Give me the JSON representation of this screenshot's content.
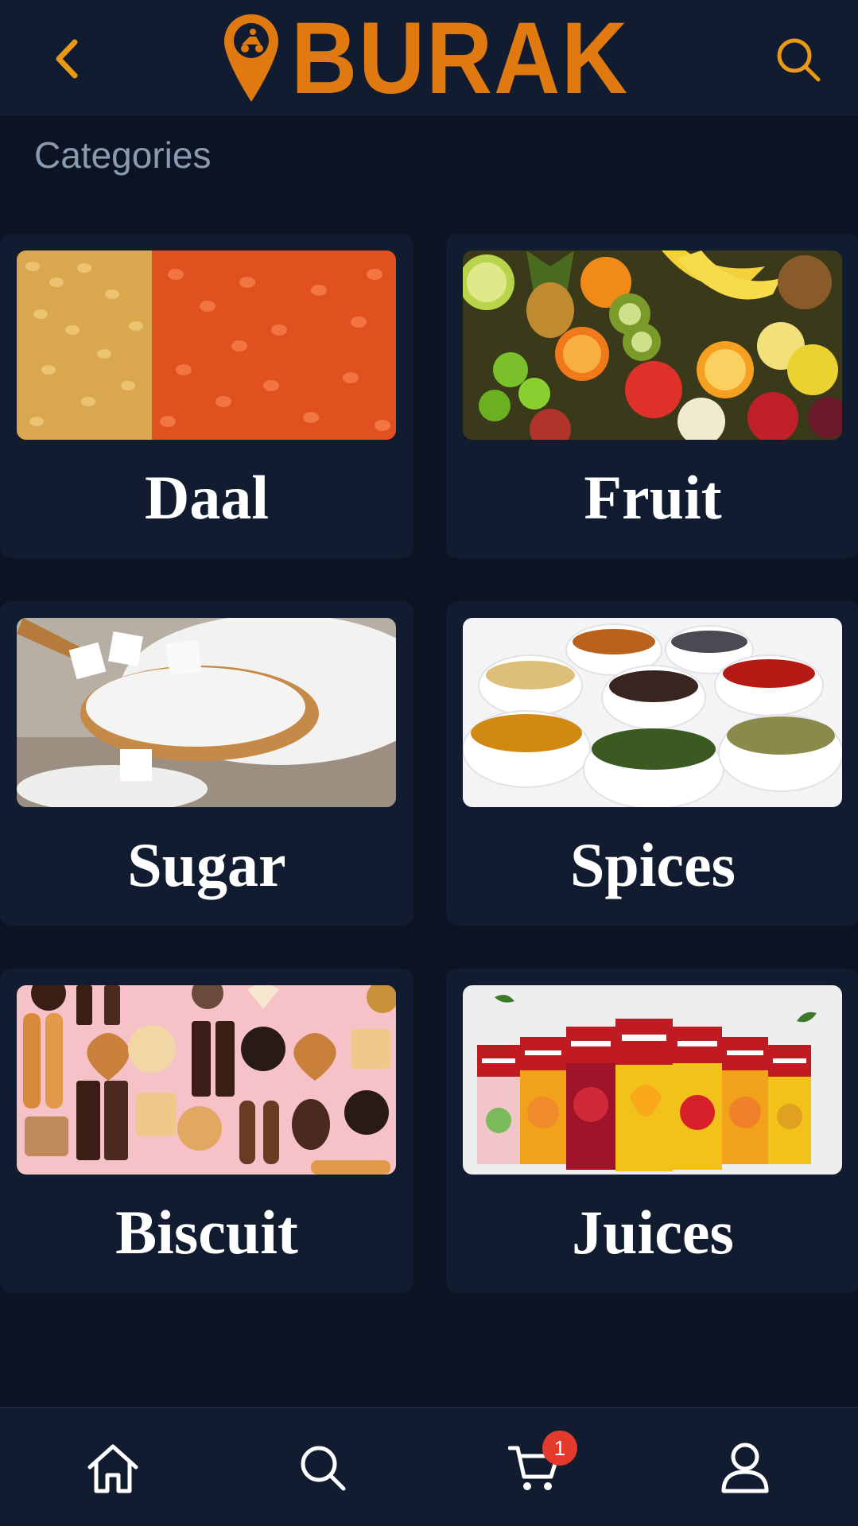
{
  "header": {
    "logo_text": "BURAK",
    "brand_color": "#e07a10",
    "back_icon": "chevron-left-icon",
    "search_icon": "search-icon"
  },
  "section": {
    "title": "Categories"
  },
  "categories": [
    {
      "label": "Daal",
      "image": "red-lentils-photo"
    },
    {
      "label": "Fruit",
      "image": "mixed-fruits-photo"
    },
    {
      "label": "Sugar",
      "image": "sugar-spoon-photo"
    },
    {
      "label": "Spices",
      "image": "spice-bowls-photo"
    },
    {
      "label": "Biscuit",
      "image": "biscuits-photo"
    },
    {
      "label": "Juices",
      "image": "fruita-vitals-juice-packs-photo"
    }
  ],
  "bottom_nav": {
    "items": [
      {
        "icon": "home-icon"
      },
      {
        "icon": "search-icon"
      },
      {
        "icon": "cart-icon",
        "badge": "1"
      },
      {
        "icon": "user-icon"
      }
    ],
    "badge_color": "#e23b2e"
  }
}
